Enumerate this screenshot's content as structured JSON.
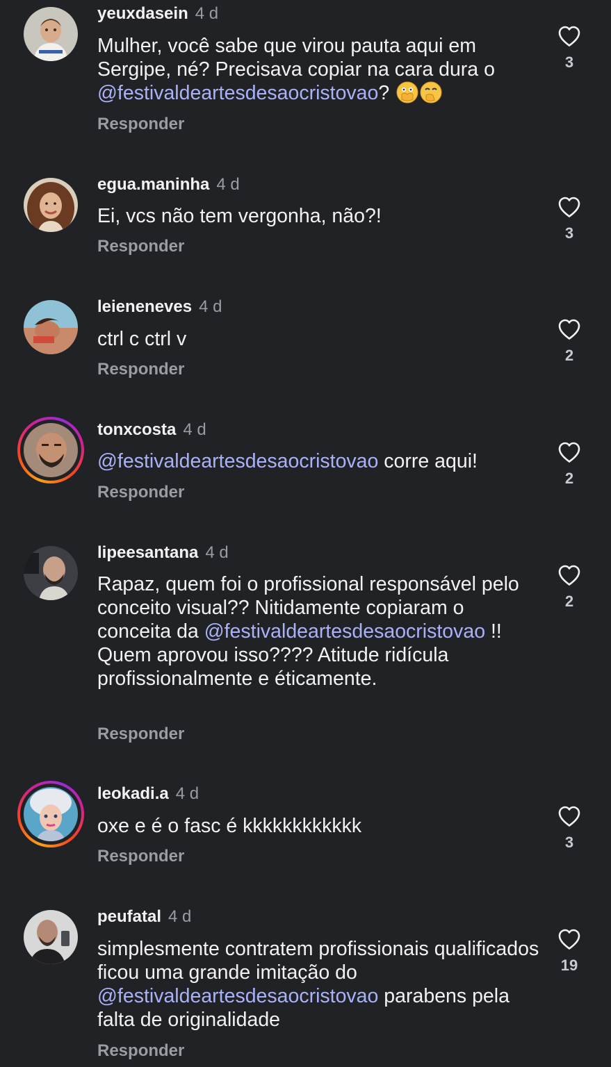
{
  "theme": {
    "background": "#212226",
    "text": "#f2f2f4",
    "muted": "#9a9ba3",
    "mention": "#a9b2f7"
  },
  "comments": [
    {
      "username": "yeuxdasein",
      "time": "4 d",
      "text_parts": [
        "Mulher, você sabe que virou pauta aqui em Sergipe, né? Precisava copiar na cara dura o ",
        "@festivaldeartesdesaocristovao",
        "? "
      ],
      "emojis": [
        "face-with-open-eyes-and-hand-over-mouth",
        "face-with-hand-over-mouth"
      ],
      "reply": "Responder",
      "likes": "3",
      "story_ring": false
    },
    {
      "username": "egua.maninha",
      "time": "4 d",
      "text": "Ei, vcs não tem vergonha, não?!",
      "reply": "Responder",
      "likes": "3",
      "story_ring": false
    },
    {
      "username": "leieneneves",
      "time": "4 d",
      "text": "ctrl c ctrl v",
      "reply": "Responder",
      "likes": "2",
      "story_ring": false
    },
    {
      "username": "tonxcosta",
      "time": "4 d",
      "text_parts": [
        "",
        "@festivaldeartesdesaocristovao",
        " corre aqui!"
      ],
      "reply": "Responder",
      "likes": "2",
      "story_ring": true
    },
    {
      "username": "lipeesantana",
      "time": "4 d",
      "text_parts": [
        "Rapaz, quem foi o profissional responsável pelo conceito visual?? Nitidamente copiaram o conceita da ",
        "@festivaldeartesdesaocristovao",
        " !! Quem aprovou isso???? Atitude ridícula profissionalmente e éticamente."
      ],
      "reply": "Responder",
      "likes": "2",
      "story_ring": false
    },
    {
      "username": "leokadi.a",
      "time": "4 d",
      "text": "oxe e é o fasc é kkkkkkkkkkkk",
      "reply": "Responder",
      "likes": "3",
      "story_ring": true
    },
    {
      "username": "peufatal",
      "time": "4 d",
      "text_parts": [
        "simplesmente contratem profissionais qualificados ficou uma grande imitação do ",
        "@festivaldeartesdesaocristovao",
        " parabens pela falta de originalidade"
      ],
      "reply": "Responder",
      "likes": "19",
      "story_ring": false
    }
  ]
}
